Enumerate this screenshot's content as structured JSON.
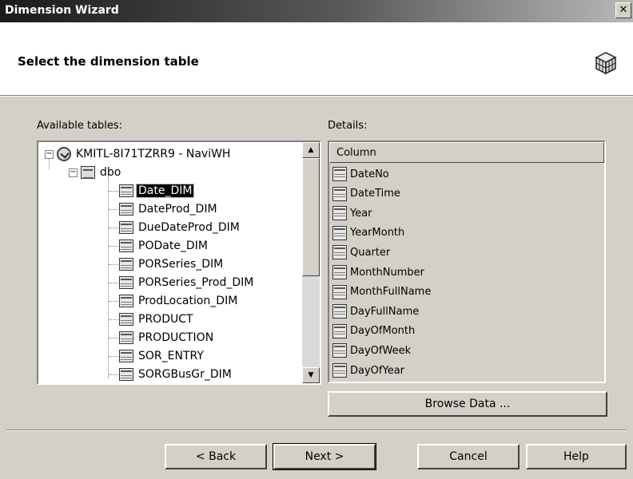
{
  "window": {
    "title": "Dimension Wizard",
    "close_glyph": "✕"
  },
  "header": {
    "heading": "Select the dimension table",
    "icon": "cube-icon"
  },
  "available": {
    "label": "Available tables:",
    "server": "KMITL-8I71TZRR9 - NaviWH",
    "schema": "dbo",
    "tables": [
      "Date_DIM",
      "DateProd_DIM",
      "DueDateProd_DIM",
      "PODate_DIM",
      "PORSeries_DIM",
      "PORSeries_Prod_DIM",
      "ProdLocation_DIM",
      "PRODUCT",
      "PRODUCTION",
      "SOR_ENTRY",
      "SORGBusGr_DIM"
    ],
    "selected_index": 0
  },
  "details": {
    "label": "Details:",
    "column_header": "Column",
    "columns": [
      "DateNo",
      "DateTime",
      "Year",
      "YearMonth",
      "Quarter",
      "MonthNumber",
      "MonthFullName",
      "DayFullName",
      "DayOfMonth",
      "DayOfWeek",
      "DayOfYear"
    ]
  },
  "buttons": {
    "browse": "Browse Data ...",
    "back": "< Back",
    "next": "Next >",
    "cancel": "Cancel",
    "help": "Help"
  }
}
